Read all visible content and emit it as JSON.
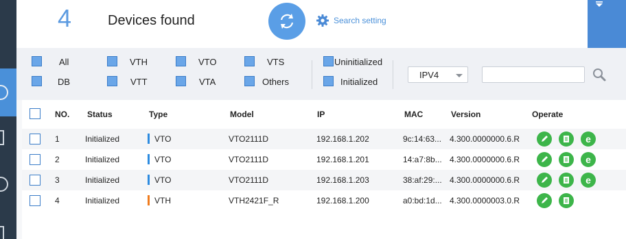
{
  "header": {
    "count": "4",
    "found_label": "Devices found",
    "search_setting_label": "Search setting"
  },
  "filters": {
    "row1": [
      "All",
      "VTH",
      "VTO",
      "VTS",
      "Uninitialized"
    ],
    "row2": [
      "DB",
      "VTT",
      "VTA",
      "Others",
      "Initialized"
    ],
    "ip_version": "IPV4",
    "search_value": ""
  },
  "table": {
    "headers": [
      "NO.",
      "Status",
      "Type",
      "Model",
      "IP",
      "MAC",
      "Version",
      "Operate"
    ],
    "rows": [
      {
        "no": "1",
        "status": "Initialized",
        "type": "VTO",
        "model": "VTO2111D",
        "ip": "192.168.1.202",
        "mac": "9c:14:63...",
        "version": "4.300.0000000.6.R"
      },
      {
        "no": "2",
        "status": "Initialized",
        "type": "VTO",
        "model": "VTO2111D",
        "ip": "192.168.1.201",
        "mac": "14:a7:8b...",
        "version": "4.300.0000000.6.R"
      },
      {
        "no": "3",
        "status": "Initialized",
        "type": "VTO",
        "model": "VTO2111D",
        "ip": "192.168.1.203",
        "mac": "38:af:29:...",
        "version": "4.300.0000000.6.R"
      },
      {
        "no": "4",
        "status": "Initialized",
        "type": "VTH",
        "model": "VTH2421F_R",
        "ip": "192.168.1.200",
        "mac": "a0:bd:1d...",
        "version": "4.300.0000003.0.R"
      }
    ]
  },
  "colors": {
    "accent": "#4a90d9",
    "type_vto": "#2d8be0",
    "type_vth": "#f07c1e",
    "operate_green": "#3db54a"
  },
  "icons": {
    "refresh": "refresh-icon",
    "settings": "gear-icon",
    "search": "magnifier-icon",
    "edit": "pencil-icon",
    "details": "document-icon",
    "web": "ie-browser-icon"
  }
}
